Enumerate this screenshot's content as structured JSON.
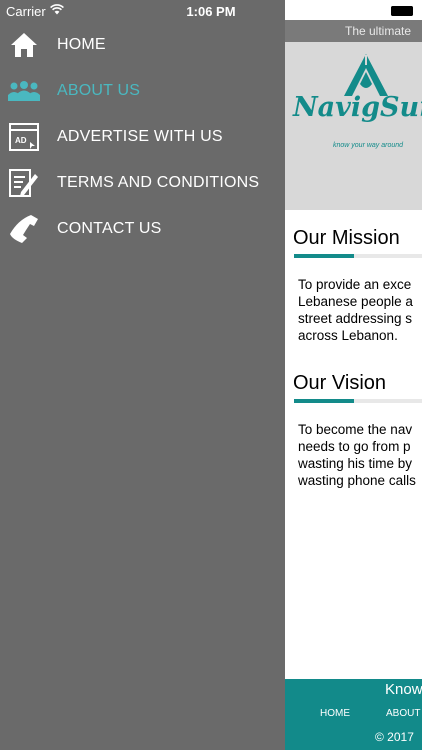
{
  "status_bar": {
    "carrier": "Carrier",
    "time": "1:06 PM"
  },
  "menu": {
    "items": [
      {
        "label": "HOME",
        "icon": "home-icon"
      },
      {
        "label": "ABOUT US",
        "icon": "people-icon",
        "active": true
      },
      {
        "label": "ADVERTISE WITH US",
        "icon": "ad-window-icon"
      },
      {
        "label": "TERMS AND CONDITIONS",
        "icon": "document-edit-icon"
      },
      {
        "label": "CONTACT US",
        "icon": "phone-icon"
      }
    ],
    "active_color": "#4ab8c0"
  },
  "content": {
    "tagline": "The ultimate",
    "logo": {
      "name": "NavigSurL",
      "subtitle": "know your way around"
    },
    "mission": {
      "heading": "Our Mission",
      "lines": [
        "To provide an exce",
        "Lebanese people a",
        "street addressing s",
        "across Lebanon."
      ]
    },
    "vision": {
      "heading": "Our Vision",
      "lines": [
        "To become the nav",
        "needs to go from p",
        "wasting his time by",
        "wasting phone calls"
      ]
    },
    "footer": {
      "tagline": "Know",
      "nav_home": "HOME",
      "nav_about": "ABOUT",
      "copyright": "© 2017"
    },
    "brand_color": "#138b8a"
  }
}
